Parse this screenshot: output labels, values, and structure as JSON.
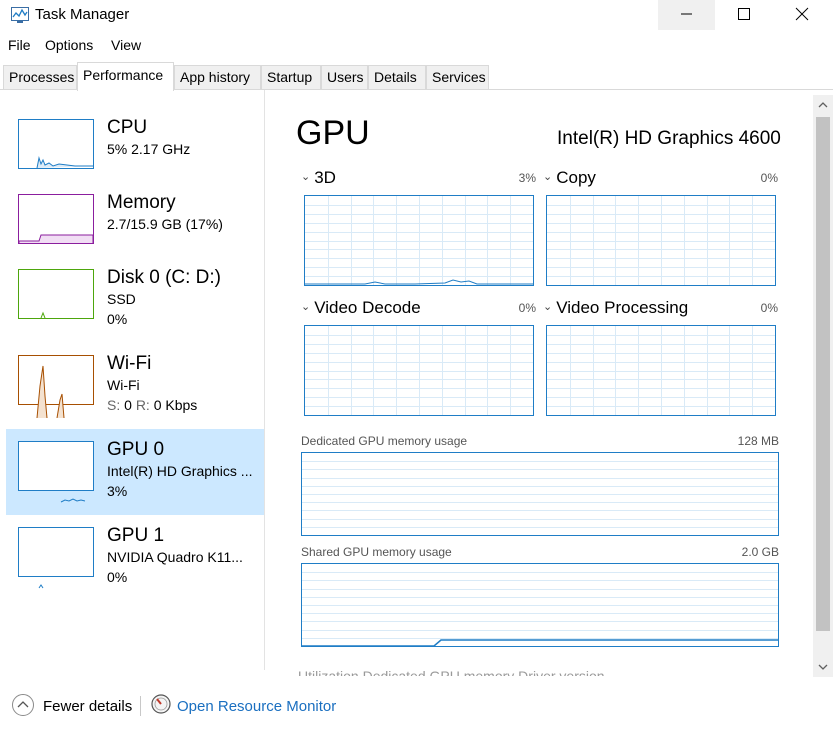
{
  "window": {
    "title": "Task Manager"
  },
  "menu": [
    "File",
    "Options",
    "View"
  ],
  "tabs": [
    "Processes",
    "Performance",
    "App history",
    "Startup",
    "Users",
    "Details",
    "Services"
  ],
  "active_tab": "Performance",
  "resources": [
    {
      "name": "CPU",
      "line1": "5% 2.17 GHz",
      "line2": "",
      "color": "#1f7dc6"
    },
    {
      "name": "Memory",
      "line1": "2.7/15.9 GB (17%)",
      "line2": "",
      "color": "#8b1e9e"
    },
    {
      "name": "Disk 0 (C: D:)",
      "line1": "SSD",
      "line2": "0%",
      "color": "#4da60c"
    },
    {
      "name": "Wi-Fi",
      "line1": "Wi-Fi",
      "line2_prefix_s": "S:",
      "line2_s": "0",
      "line2_prefix_r": "R:",
      "line2_r": "0 Kbps",
      "color": "#a74f01"
    },
    {
      "name": "GPU 0",
      "line1": "Intel(R) HD Graphics ...",
      "line2": "3%",
      "color": "#1f7dc6"
    },
    {
      "name": "GPU 1",
      "line1": "NVIDIA Quadro K11...",
      "line2": "0%",
      "color": "#1f7dc6"
    }
  ],
  "selected_resource": "GPU 0",
  "main": {
    "title": "GPU",
    "model": "Intel(R) HD Graphics 4600",
    "engines": [
      {
        "label": "3D",
        "value": "3%"
      },
      {
        "label": "Copy",
        "value": "0%"
      },
      {
        "label": "Video Decode",
        "value": "0%"
      },
      {
        "label": "Video Processing",
        "value": "0%"
      }
    ],
    "dedicated": {
      "label": "Dedicated GPU memory usage",
      "max": "128 MB"
    },
    "shared": {
      "label": "Shared GPU memory usage",
      "max": "2.0 GB"
    },
    "cutoff_text": "Utilization          Dedicated GPU memory          Driver version"
  },
  "footer": {
    "fewer_details": "Fewer details",
    "open_monitor": "Open Resource Monitor"
  },
  "colors": {
    "accent": "#1f7dc6",
    "selected_bg": "#cce8ff",
    "link": "#1a6fc0"
  }
}
